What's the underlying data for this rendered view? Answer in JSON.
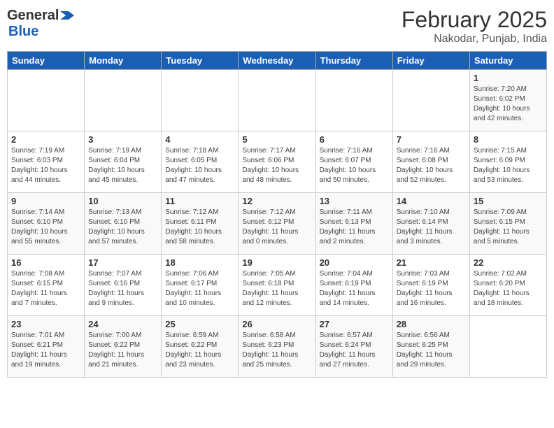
{
  "header": {
    "logo_line1": "General",
    "logo_line2": "Blue",
    "main_title": "February 2025",
    "sub_title": "Nakodar, Punjab, India"
  },
  "days_of_week": [
    "Sunday",
    "Monday",
    "Tuesday",
    "Wednesday",
    "Thursday",
    "Friday",
    "Saturday"
  ],
  "weeks": [
    [
      {
        "day": "",
        "info": ""
      },
      {
        "day": "",
        "info": ""
      },
      {
        "day": "",
        "info": ""
      },
      {
        "day": "",
        "info": ""
      },
      {
        "day": "",
        "info": ""
      },
      {
        "day": "",
        "info": ""
      },
      {
        "day": "1",
        "info": "Sunrise: 7:20 AM\nSunset: 6:02 PM\nDaylight: 10 hours\nand 42 minutes."
      }
    ],
    [
      {
        "day": "2",
        "info": "Sunrise: 7:19 AM\nSunset: 6:03 PM\nDaylight: 10 hours\nand 44 minutes."
      },
      {
        "day": "3",
        "info": "Sunrise: 7:19 AM\nSunset: 6:04 PM\nDaylight: 10 hours\nand 45 minutes."
      },
      {
        "day": "4",
        "info": "Sunrise: 7:18 AM\nSunset: 6:05 PM\nDaylight: 10 hours\nand 47 minutes."
      },
      {
        "day": "5",
        "info": "Sunrise: 7:17 AM\nSunset: 6:06 PM\nDaylight: 10 hours\nand 48 minutes."
      },
      {
        "day": "6",
        "info": "Sunrise: 7:16 AM\nSunset: 6:07 PM\nDaylight: 10 hours\nand 50 minutes."
      },
      {
        "day": "7",
        "info": "Sunrise: 7:16 AM\nSunset: 6:08 PM\nDaylight: 10 hours\nand 52 minutes."
      },
      {
        "day": "8",
        "info": "Sunrise: 7:15 AM\nSunset: 6:09 PM\nDaylight: 10 hours\nand 53 minutes."
      }
    ],
    [
      {
        "day": "9",
        "info": "Sunrise: 7:14 AM\nSunset: 6:10 PM\nDaylight: 10 hours\nand 55 minutes."
      },
      {
        "day": "10",
        "info": "Sunrise: 7:13 AM\nSunset: 6:10 PM\nDaylight: 10 hours\nand 57 minutes."
      },
      {
        "day": "11",
        "info": "Sunrise: 7:12 AM\nSunset: 6:11 PM\nDaylight: 10 hours\nand 58 minutes."
      },
      {
        "day": "12",
        "info": "Sunrise: 7:12 AM\nSunset: 6:12 PM\nDaylight: 11 hours\nand 0 minutes."
      },
      {
        "day": "13",
        "info": "Sunrise: 7:11 AM\nSunset: 6:13 PM\nDaylight: 11 hours\nand 2 minutes."
      },
      {
        "day": "14",
        "info": "Sunrise: 7:10 AM\nSunset: 6:14 PM\nDaylight: 11 hours\nand 3 minutes."
      },
      {
        "day": "15",
        "info": "Sunrise: 7:09 AM\nSunset: 6:15 PM\nDaylight: 11 hours\nand 5 minutes."
      }
    ],
    [
      {
        "day": "16",
        "info": "Sunrise: 7:08 AM\nSunset: 6:15 PM\nDaylight: 11 hours\nand 7 minutes."
      },
      {
        "day": "17",
        "info": "Sunrise: 7:07 AM\nSunset: 6:16 PM\nDaylight: 11 hours\nand 9 minutes."
      },
      {
        "day": "18",
        "info": "Sunrise: 7:06 AM\nSunset: 6:17 PM\nDaylight: 11 hours\nand 10 minutes."
      },
      {
        "day": "19",
        "info": "Sunrise: 7:05 AM\nSunset: 6:18 PM\nDaylight: 11 hours\nand 12 minutes."
      },
      {
        "day": "20",
        "info": "Sunrise: 7:04 AM\nSunset: 6:19 PM\nDaylight: 11 hours\nand 14 minutes."
      },
      {
        "day": "21",
        "info": "Sunrise: 7:03 AM\nSunset: 6:19 PM\nDaylight: 11 hours\nand 16 minutes."
      },
      {
        "day": "22",
        "info": "Sunrise: 7:02 AM\nSunset: 6:20 PM\nDaylight: 11 hours\nand 18 minutes."
      }
    ],
    [
      {
        "day": "23",
        "info": "Sunrise: 7:01 AM\nSunset: 6:21 PM\nDaylight: 11 hours\nand 19 minutes."
      },
      {
        "day": "24",
        "info": "Sunrise: 7:00 AM\nSunset: 6:22 PM\nDaylight: 11 hours\nand 21 minutes."
      },
      {
        "day": "25",
        "info": "Sunrise: 6:59 AM\nSunset: 6:22 PM\nDaylight: 11 hours\nand 23 minutes."
      },
      {
        "day": "26",
        "info": "Sunrise: 6:58 AM\nSunset: 6:23 PM\nDaylight: 11 hours\nand 25 minutes."
      },
      {
        "day": "27",
        "info": "Sunrise: 6:57 AM\nSunset: 6:24 PM\nDaylight: 11 hours\nand 27 minutes."
      },
      {
        "day": "28",
        "info": "Sunrise: 6:56 AM\nSunset: 6:25 PM\nDaylight: 11 hours\nand 29 minutes."
      },
      {
        "day": "",
        "info": ""
      }
    ]
  ]
}
